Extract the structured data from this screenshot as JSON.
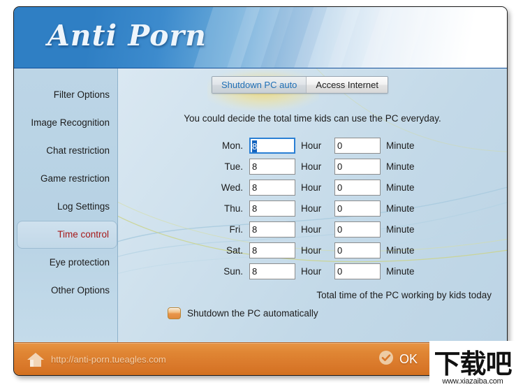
{
  "window": {
    "logo": "Anti Porn"
  },
  "sidebar": {
    "items": [
      {
        "label": "Filter Options",
        "selected": false
      },
      {
        "label": "Image Recognition",
        "selected": false
      },
      {
        "label": "Chat restriction",
        "selected": false
      },
      {
        "label": "Game restriction",
        "selected": false
      },
      {
        "label": "Log Settings",
        "selected": false
      },
      {
        "label": "Time control",
        "selected": true
      },
      {
        "label": "Eye protection",
        "selected": false
      },
      {
        "label": "Other Options",
        "selected": false
      }
    ]
  },
  "content": {
    "tabs": [
      {
        "label": "Shutdown PC auto",
        "active": true
      },
      {
        "label": "Access Internet",
        "active": false
      }
    ],
    "intro": "You could decide the total time kids can use the PC everyday.",
    "hour_unit": "Hour",
    "minute_unit": "Minute",
    "rows": [
      {
        "day": "Mon.",
        "hours": "8",
        "minutes": "0",
        "focused": true
      },
      {
        "day": "Tue.",
        "hours": "8",
        "minutes": "0",
        "focused": false
      },
      {
        "day": "Wed.",
        "hours": "8",
        "minutes": "0",
        "focused": false
      },
      {
        "day": "Thu.",
        "hours": "8",
        "minutes": "0",
        "focused": false
      },
      {
        "day": "Fri.",
        "hours": "8",
        "minutes": "0",
        "focused": false
      },
      {
        "day": "Sat.",
        "hours": "8",
        "minutes": "0",
        "focused": false
      },
      {
        "day": "Sun.",
        "hours": "8",
        "minutes": "0",
        "focused": false
      }
    ],
    "total_time_text": "Total time of the PC working by kids today",
    "auto_shutdown_label": "Shutdown the PC automatically",
    "auto_shutdown_checked": false
  },
  "footer": {
    "url": "http://anti-porn.tueagles.com",
    "ok_label": "OK",
    "home_icon": "home-icon",
    "ok_icon": "check-circle-icon"
  },
  "watermark": {
    "cjk": "下载吧",
    "url": "www.xiazaiba.com"
  },
  "colors": {
    "header_blue": "#2f7fc4",
    "footer_orange": "#e08634",
    "selected_item_red": "#a51919",
    "active_tab_blue": "#1f6fb5",
    "focus_border": "#2a7fd4",
    "selection_blue": "#1565c0"
  }
}
